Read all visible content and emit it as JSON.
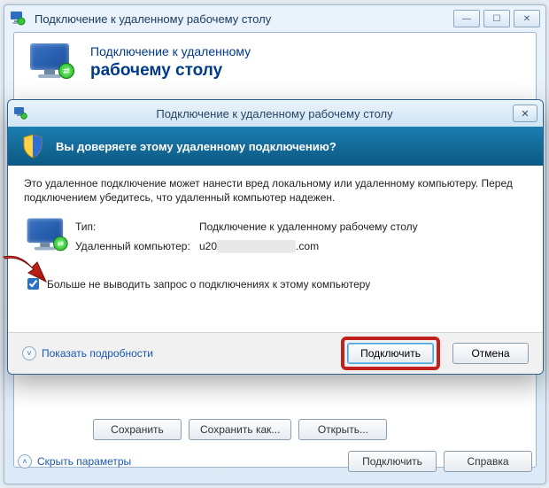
{
  "colors": {
    "accent": "#003a8a",
    "band_top": "#1b7eb1",
    "band_bottom": "#0d5882",
    "ring": "#c1201d"
  },
  "back_window": {
    "title": "Подключение к удаленному рабочему столу",
    "banner_line1": "Подключение к удаленному",
    "banner_line2": "рабочему столу",
    "buttons": {
      "save": "Сохранить",
      "save_as": "Сохранить как...",
      "open": "Открыть..."
    },
    "hide_params": "Скрыть параметры",
    "connect": "Подключить",
    "help": "Справка"
  },
  "dialog": {
    "title": "Подключение к удаленному рабочему столу",
    "band_question": "Вы доверяете этому удаленному подключению?",
    "warn_text": "Это удаленное подключение может нанести вред локальному или удаленному компьютеру. Перед подключением убедитесь, что удаленный компьютер надежен.",
    "labels": {
      "type": "Тип:",
      "remote_pc": "Удаленный компьютер:"
    },
    "values": {
      "type": "Подключение к удаленному рабочему столу",
      "remote_pc_prefix": "u20",
      "remote_pc_masked": "██████████",
      "remote_pc_suffix": ".com"
    },
    "checkbox_label": "Больше не выводить запрос о подключениях к этому компьютеру",
    "checkbox_checked": true,
    "details": "Показать подробности",
    "buttons": {
      "connect": "Подключить",
      "cancel": "Отмена"
    }
  },
  "icons": {
    "minimize": "—",
    "maximize": "☐",
    "close": "✕",
    "chev_up": "˄",
    "chev_down": "˅",
    "badge_arrows": "⇄"
  }
}
